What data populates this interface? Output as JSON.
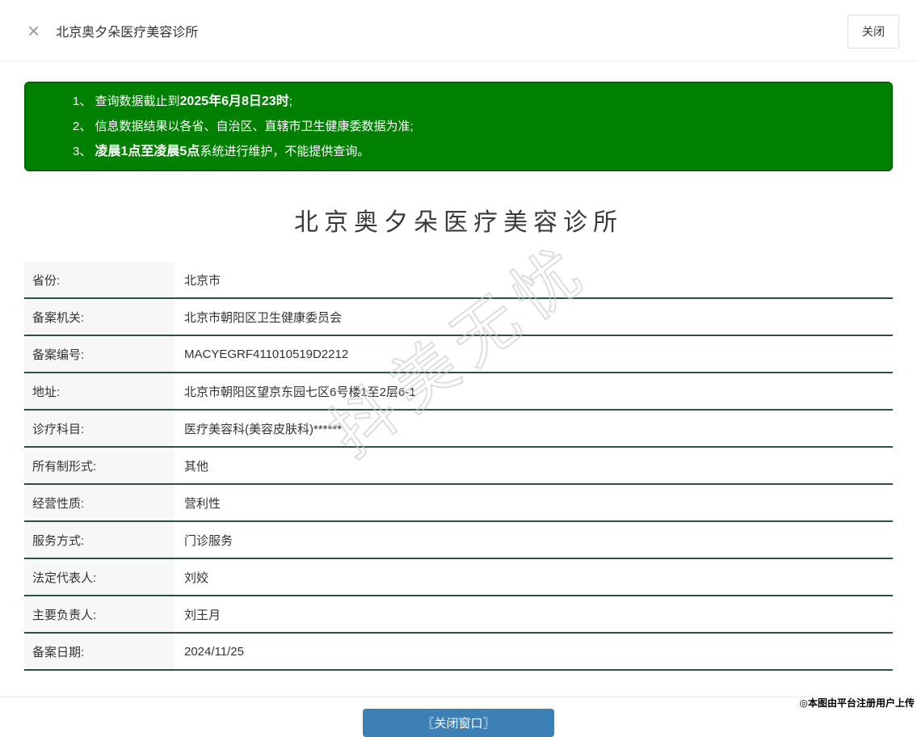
{
  "header": {
    "close_x": "×",
    "title": "北京奥夕朵医疗美容诊所",
    "close_button": "关闭"
  },
  "notice": {
    "lines": [
      {
        "segments": [
          {
            "text": "1、 查询数据截止到",
            "bold": false
          },
          {
            "text": "2025年6月8日23时",
            "bold": true
          },
          {
            "text": ";",
            "bold": false
          }
        ]
      },
      {
        "segments": [
          {
            "text": "2、 信息数据结果以各省、自治区、直辖市卫生健康委数据为准;",
            "bold": false
          }
        ]
      },
      {
        "segments": [
          {
            "text": "3、 ",
            "bold": false
          },
          {
            "text": "凌晨1点至凌晨5点",
            "bold": true
          },
          {
            "text": "系统进行维护，不能提供查询。",
            "bold": false
          }
        ]
      }
    ]
  },
  "detail": {
    "title": "北京奥夕朵医疗美容诊所",
    "rows": [
      {
        "label": "省份:",
        "value": "北京市"
      },
      {
        "label": "备案机关:",
        "value": "北京市朝阳区卫生健康委员会"
      },
      {
        "label": "备案编号:",
        "value": "MACYEGRF411010519D2212"
      },
      {
        "label": "地址:",
        "value": "北京市朝阳区望京东园七区6号楼1至2层6-1"
      },
      {
        "label": "诊疗科目:",
        "value": "医疗美容科(美容皮肤科)******"
      },
      {
        "label": "所有制形式:",
        "value": "其他"
      },
      {
        "label": "经营性质:",
        "value": "营利性"
      },
      {
        "label": "服务方式:",
        "value": "门诊服务"
      },
      {
        "label": "法定代表人:",
        "value": "刘姣"
      },
      {
        "label": "主要负责人:",
        "value": "刘王月"
      },
      {
        "label": "备案日期:",
        "value": "2024/11/25"
      }
    ]
  },
  "footer": {
    "close_window_button": "〖关闭窗口〗"
  },
  "watermark": "抖美无忧",
  "stamp": "◎本图由平台注册用户上传",
  "colors": {
    "notice_bg": "#008000",
    "notice_border": "#006400",
    "row_border": "#2c4f46",
    "button_blue": "#3d80b5"
  }
}
